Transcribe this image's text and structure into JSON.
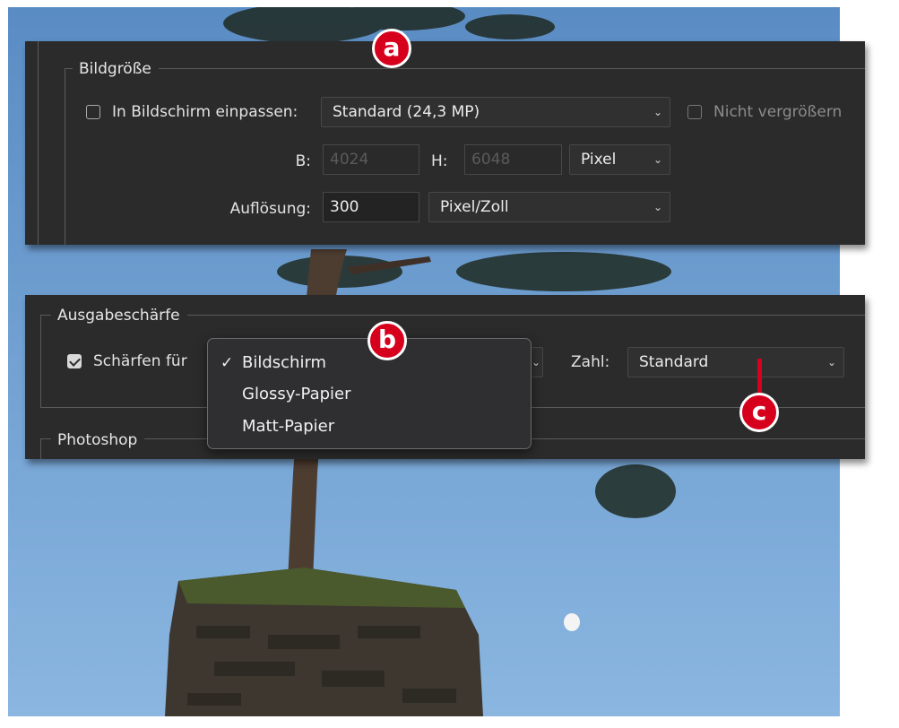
{
  "bildgroesse": {
    "group_title": "Bildgröße",
    "fit_checkbox_label": "In Bildschirm einpassen:",
    "fit_select_value": "Standard  (24,3 MP)",
    "no_enlarge_label": "Nicht vergrößern",
    "width_label": "B:",
    "width_value": "4024",
    "height_label": "H:",
    "height_value": "6048",
    "unit_select_value": "Pixel",
    "resolution_label": "Auflösung:",
    "resolution_value": "300",
    "resolution_unit_value": "Pixel/Zoll"
  },
  "ausgabeschaerfe": {
    "group_title": "Ausgabeschärfe",
    "sharpen_label": "Schärfen für",
    "sharpen_checked": true,
    "amount_label": "Zahl:",
    "amount_value": "Standard",
    "menu": {
      "options": [
        "Bildschirm",
        "Glossy-Papier",
        "Matt-Papier"
      ],
      "selected": "Bildschirm",
      "check_glyph": "✓"
    }
  },
  "photoshop": {
    "group_title": "Photoshop"
  },
  "badges": {
    "a": "a",
    "b": "b",
    "c": "c",
    "color": "#d6001c"
  },
  "icons": {
    "dropdown": "chevron-down-icon",
    "checkmark": "checkmark-icon"
  }
}
